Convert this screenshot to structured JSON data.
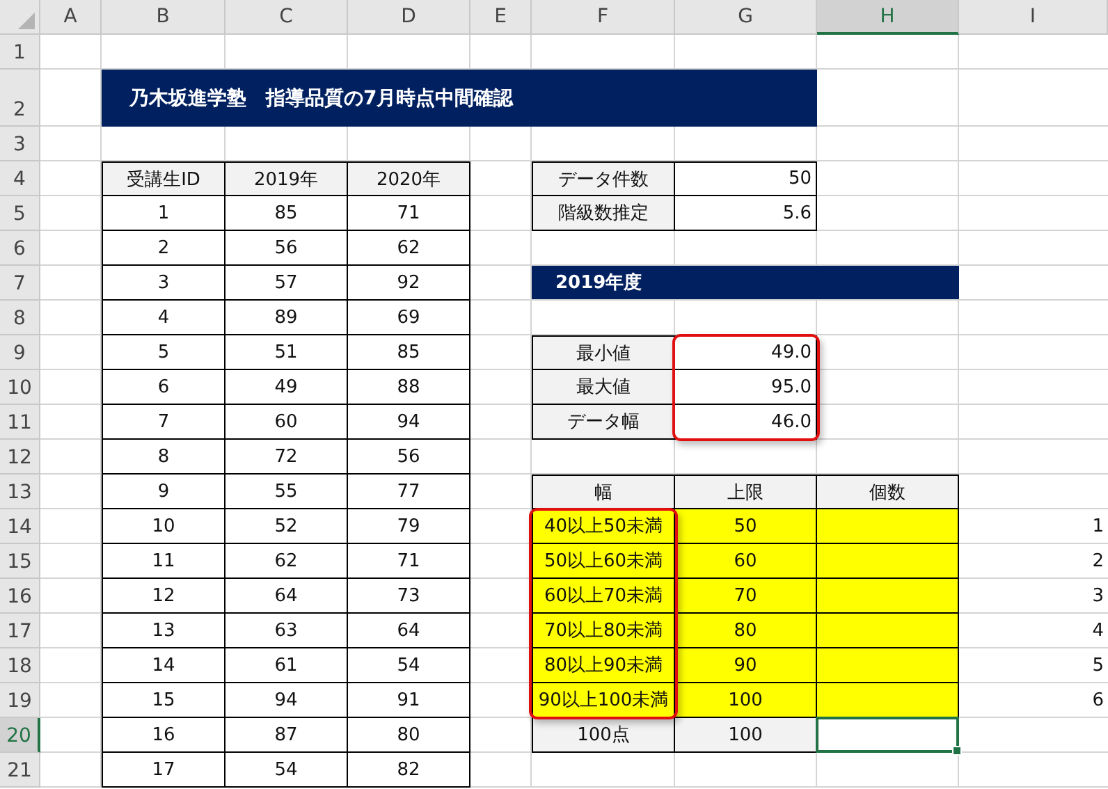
{
  "column_headers": [
    {
      "label": "A",
      "selected": false
    },
    {
      "label": "B",
      "selected": false
    },
    {
      "label": "C",
      "selected": false
    },
    {
      "label": "D",
      "selected": false
    },
    {
      "label": "E",
      "selected": false
    },
    {
      "label": "F",
      "selected": false
    },
    {
      "label": "G",
      "selected": false
    },
    {
      "label": "H",
      "selected": true
    },
    {
      "label": "I",
      "selected": false
    }
  ],
  "row_headers": [
    {
      "label": "1",
      "selected": false
    },
    {
      "label": "2",
      "selected": false
    },
    {
      "label": "3",
      "selected": false
    },
    {
      "label": "4",
      "selected": false
    },
    {
      "label": "5",
      "selected": false
    },
    {
      "label": "6",
      "selected": false
    },
    {
      "label": "7",
      "selected": false
    },
    {
      "label": "8",
      "selected": false
    },
    {
      "label": "9",
      "selected": false
    },
    {
      "label": "10",
      "selected": false
    },
    {
      "label": "11",
      "selected": false
    },
    {
      "label": "12",
      "selected": false
    },
    {
      "label": "13",
      "selected": false
    },
    {
      "label": "14",
      "selected": false
    },
    {
      "label": "15",
      "selected": false
    },
    {
      "label": "16",
      "selected": false
    },
    {
      "label": "17",
      "selected": false
    },
    {
      "label": "18",
      "selected": false
    },
    {
      "label": "19",
      "selected": false
    },
    {
      "label": "20",
      "selected": true
    },
    {
      "label": "21",
      "selected": false
    }
  ],
  "title": "乃木坂進学塾　指導品質の7月時点中間確認",
  "scores_table": {
    "columns": [
      "受講生ID",
      "2019年",
      "2020年"
    ],
    "rows": [
      [
        "1",
        "85",
        "71"
      ],
      [
        "2",
        "56",
        "62"
      ],
      [
        "3",
        "57",
        "92"
      ],
      [
        "4",
        "89",
        "69"
      ],
      [
        "5",
        "51",
        "85"
      ],
      [
        "6",
        "49",
        "88"
      ],
      [
        "7",
        "60",
        "94"
      ],
      [
        "8",
        "72",
        "56"
      ],
      [
        "9",
        "55",
        "77"
      ],
      [
        "10",
        "52",
        "79"
      ],
      [
        "11",
        "62",
        "71"
      ],
      [
        "12",
        "64",
        "73"
      ],
      [
        "13",
        "63",
        "64"
      ],
      [
        "14",
        "61",
        "54"
      ],
      [
        "15",
        "94",
        "91"
      ],
      [
        "16",
        "87",
        "80"
      ],
      [
        "17",
        "54",
        "82"
      ]
    ]
  },
  "summary_table": {
    "rows": [
      {
        "label": "データ件数",
        "value": "50"
      },
      {
        "label": "階級数推定",
        "value": "5.6"
      }
    ]
  },
  "section_heading": "2019年度",
  "range_table": {
    "values_highlighted": true,
    "rows": [
      {
        "label": "最小値",
        "value": "49.0"
      },
      {
        "label": "最大値",
        "value": "95.0"
      },
      {
        "label": "データ幅",
        "value": "46.0"
      }
    ]
  },
  "frequency_table": {
    "columns": [
      "幅",
      "上限",
      "個数"
    ],
    "classes_highlighted": true,
    "rows": [
      {
        "class": "40以上50未満",
        "upper": "50",
        "filled": true,
        "index": "1"
      },
      {
        "class": "50以上60未満",
        "upper": "60",
        "filled": true,
        "index": "2"
      },
      {
        "class": "60以上70未満",
        "upper": "70",
        "filled": true,
        "index": "3"
      },
      {
        "class": "70以上80未満",
        "upper": "80",
        "filled": true,
        "index": "4"
      },
      {
        "class": "80以上90未満",
        "upper": "90",
        "filled": true,
        "index": "5"
      },
      {
        "class": "90以上100未満",
        "upper": "100",
        "filled": true,
        "index": "6"
      }
    ],
    "footer": {
      "class": "100点",
      "upper": "100"
    }
  }
}
